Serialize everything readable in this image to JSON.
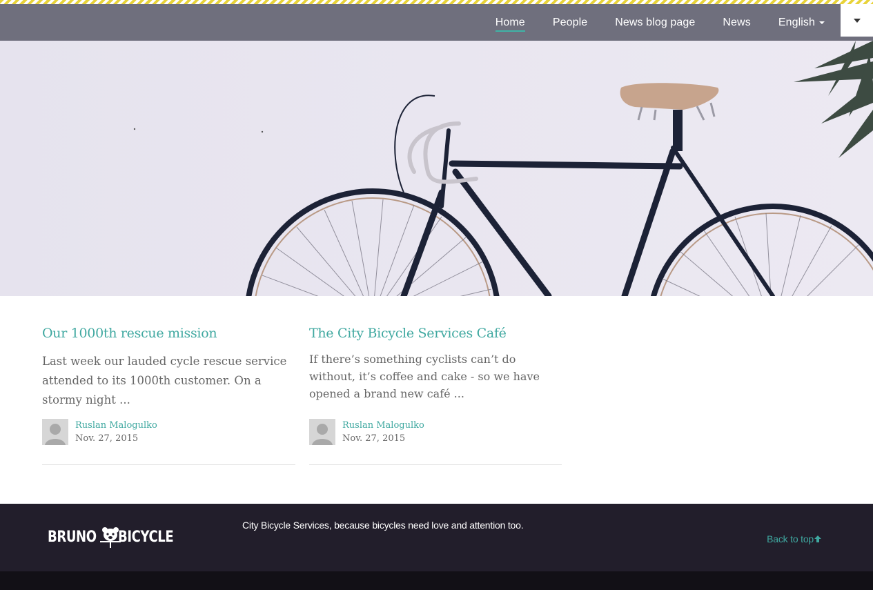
{
  "navbar": {
    "items": [
      {
        "label": "Home",
        "active": true
      },
      {
        "label": "People",
        "active": false
      },
      {
        "label": "News blog page",
        "active": false
      },
      {
        "label": "News",
        "active": false
      }
    ],
    "language": "English",
    "toggle_icon": "caret-down-icon"
  },
  "colors": {
    "accent": "#3fa8a0",
    "navbar_bg": "#6f6f7d",
    "footer_bg": "#221e2b",
    "stripe": "#e8d33a"
  },
  "articles": [
    {
      "title": "Our 1000th rescue mission",
      "lead": "Last week our lauded cycle rescue service attended to its 1000th customer. On a stormy night ...",
      "author": "Ruslan Malogulko",
      "date": "Nov. 27, 2015"
    },
    {
      "title": "The City Bicycle Services Café",
      "lead": "If there’s something cyclists can’t do without, it’s coffee and cake - so we have opened a brand new café ...",
      "author": "Ruslan Malogulko",
      "date": "Nov. 27, 2015"
    }
  ],
  "footer": {
    "logo_left": "BRUNO",
    "logo_right": "BICYCLE",
    "tagline": "City Bicycle Services, because bicycles need love and attention too.",
    "back_to_top": "Back to top"
  }
}
